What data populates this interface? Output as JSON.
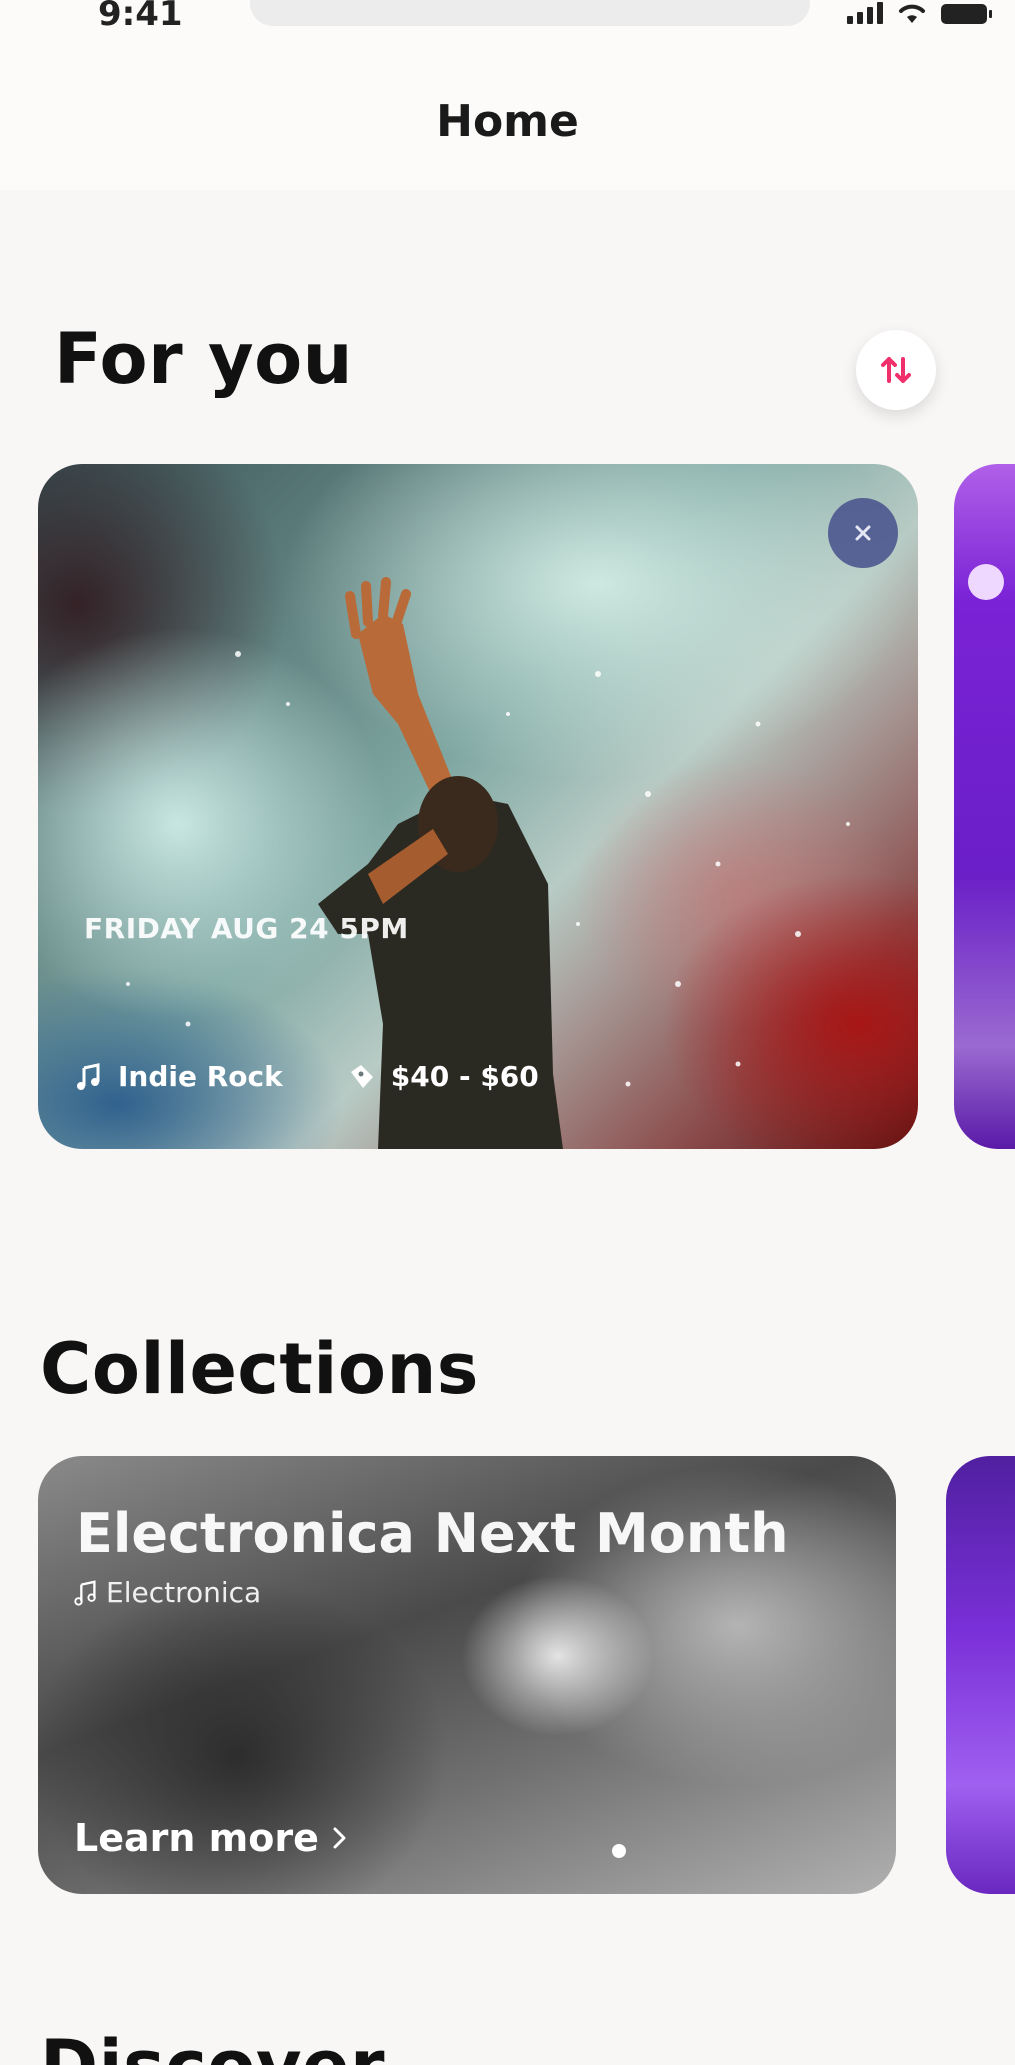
{
  "status_bar": {
    "time": "9:41"
  },
  "nav": {
    "title": "Home"
  },
  "for_you": {
    "title": "For you",
    "sort_icon": "sort-arrows-icon",
    "event": {
      "date": "FRIDAY AUG 24 5PM",
      "genre": "Indie Rock",
      "price": "$40 - $60",
      "close_icon": "close-icon",
      "genre_icon": "music-note-icon",
      "price_icon": "ticket-icon"
    }
  },
  "collections": {
    "title": "Collections",
    "card": {
      "title": "Electronica Next Month",
      "genre": "Electronica",
      "cta": "Learn more"
    }
  },
  "discover": {
    "title": "Discover"
  },
  "colors": {
    "accent": "#f0306a",
    "background": "#f9f7f6",
    "close_button": "#46508c"
  }
}
